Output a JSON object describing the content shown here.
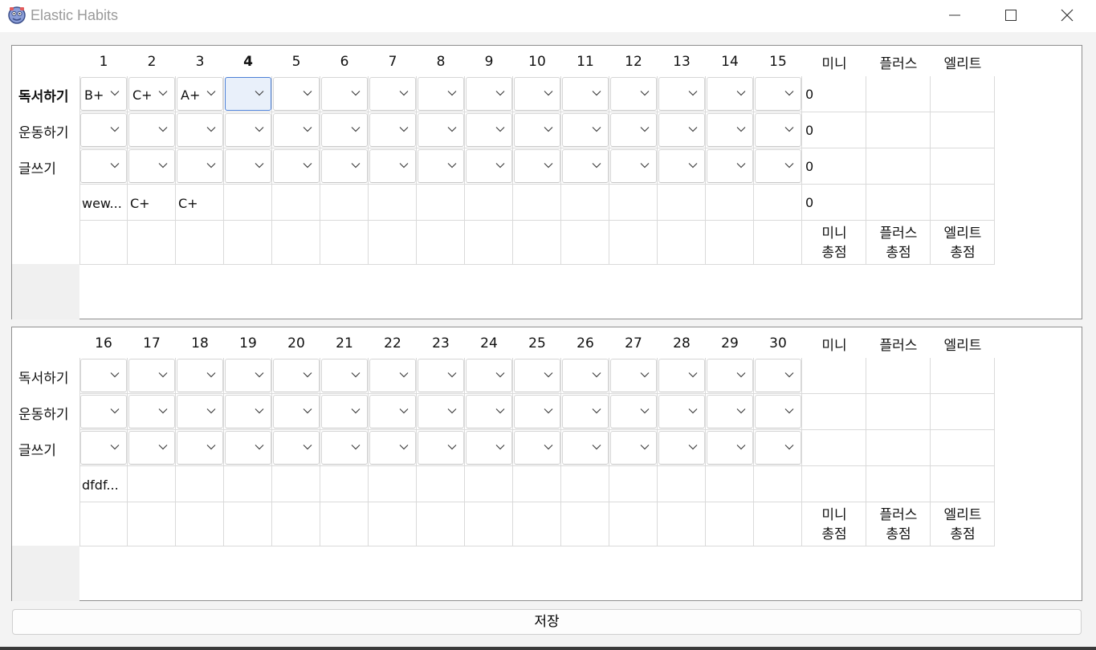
{
  "window": {
    "title": "Elastic Habits",
    "icon": "app-logo-icon",
    "controls": [
      "minimize-icon",
      "maximize-icon",
      "close-icon"
    ]
  },
  "habits": [
    "독서하기",
    "운동하기",
    "글쓰기"
  ],
  "level_headers": [
    "미니",
    "플러스",
    "엘리트"
  ],
  "total_headers": [
    "미니\n총점",
    "플러스\n총점",
    "엘리트\n총점"
  ],
  "top": {
    "days": [
      "1",
      "2",
      "3",
      "4",
      "5",
      "6",
      "7",
      "8",
      "9",
      "10",
      "11",
      "12",
      "13",
      "14",
      "15"
    ],
    "bold_day_index": 3,
    "bold_habit_index": 0,
    "grades": [
      [
        "B+",
        "C+",
        "A+",
        "",
        "",
        "",
        "",
        "",
        "",
        "",
        "",
        "",
        "",
        "",
        ""
      ],
      [
        "",
        "",
        "",
        "",
        "",
        "",
        "",
        "",
        "",
        "",
        "",
        "",
        "",
        "",
        ""
      ],
      [
        "",
        "",
        "",
        "",
        "",
        "",
        "",
        "",
        "",
        "",
        "",
        "",
        "",
        "",
        ""
      ]
    ],
    "focused_cell": {
      "row": 0,
      "col": 3
    },
    "counts": [
      "0",
      "0",
      "0",
      "0"
    ],
    "memo": [
      "wew...",
      "C+",
      "C+",
      "",
      "",
      "",
      "",
      "",
      "",
      "",
      "",
      "",
      "",
      "",
      ""
    ]
  },
  "bottom": {
    "days": [
      "16",
      "17",
      "18",
      "19",
      "20",
      "21",
      "22",
      "23",
      "24",
      "25",
      "26",
      "27",
      "28",
      "29",
      "30"
    ],
    "grades": [
      [
        "",
        "",
        "",
        "",
        "",
        "",
        "",
        "",
        "",
        "",
        "",
        "",
        "",
        "",
        ""
      ],
      [
        "",
        "",
        "",
        "",
        "",
        "",
        "",
        "",
        "",
        "",
        "",
        "",
        "",
        "",
        ""
      ],
      [
        "",
        "",
        "",
        "",
        "",
        "",
        "",
        "",
        "",
        "",
        "",
        "",
        "",
        "",
        ""
      ]
    ],
    "counts": [
      "",
      "",
      "",
      ""
    ],
    "memo": [
      "dfdf...",
      "",
      "",
      "",
      "",
      "",
      "",
      "",
      "",
      "",
      "",
      "",
      "",
      "",
      ""
    ]
  },
  "save_label": "저장"
}
